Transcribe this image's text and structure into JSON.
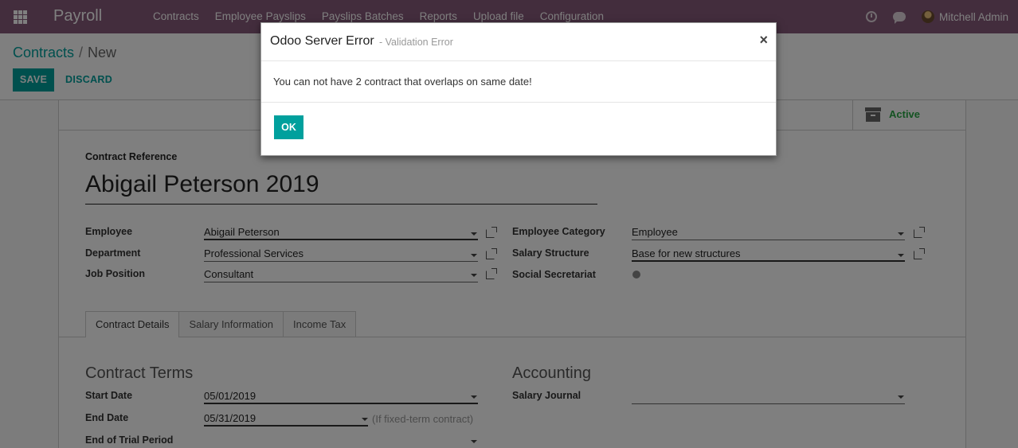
{
  "navbar": {
    "app_name": "Payroll",
    "menu": [
      "Contracts",
      "Employee Payslips",
      "Payslips Batches",
      "Reports",
      "Upload file",
      "Configuration"
    ],
    "user_name": "Mitchell Admin"
  },
  "breadcrumb": {
    "parent": "Contracts",
    "separator": "/",
    "current": "New"
  },
  "actions": {
    "save_label": "SAVE",
    "discard_label": "DISCARD"
  },
  "status": {
    "active_label": "Active"
  },
  "form": {
    "ref_label": "Contract Reference",
    "ref_value": "Abigail Peterson 2019",
    "employee_label": "Employee",
    "employee_value": "Abigail Peterson",
    "department_label": "Department",
    "department_value": "Professional Services",
    "job_label": "Job Position",
    "job_value": "Consultant",
    "category_label": "Employee Category",
    "category_value": "Employee",
    "structure_label": "Salary Structure",
    "structure_value": "Base for new structures",
    "secretariat_label": "Social Secretariat"
  },
  "tabs": [
    "Contract Details",
    "Salary Information",
    "Income Tax"
  ],
  "contract_terms": {
    "title": "Contract Terms",
    "start_label": "Start Date",
    "start_value": "05/01/2019",
    "end_label": "End Date",
    "end_value": "05/31/2019",
    "end_hint": "(If fixed-term contract)",
    "trial_label": "End of Trial Period"
  },
  "accounting": {
    "title": "Accounting",
    "journal_label": "Salary Journal"
  },
  "dialog": {
    "title": "Odoo Server Error",
    "subtitle": "- Validation Error",
    "close_symbol": "×",
    "message": "You can not have 2 contract that overlaps on same date!",
    "ok_label": "OK"
  },
  "colors": {
    "navbar": "#875a7b",
    "accent": "#00a09d",
    "active": "#28a745"
  }
}
